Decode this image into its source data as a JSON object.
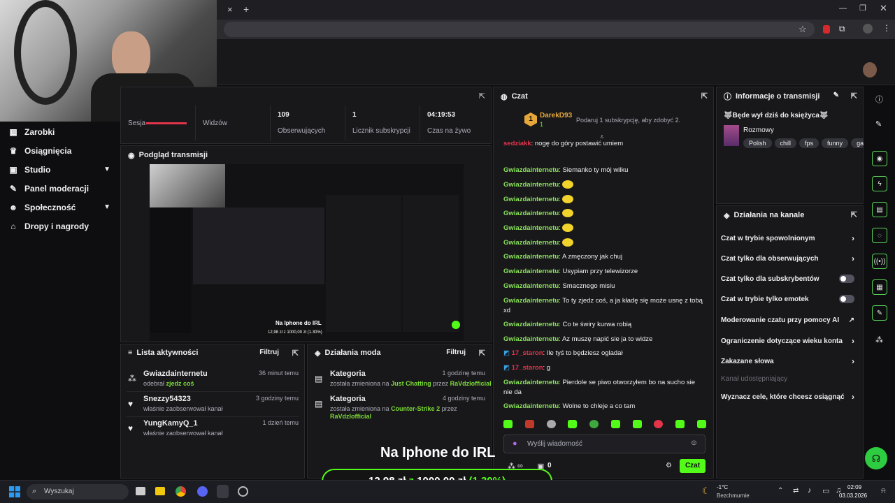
{
  "browser": {
    "new_tab": "+",
    "close": "×"
  },
  "sidebar": {
    "items": [
      {
        "icon": "bar-chart-icon",
        "glyph": "▦",
        "label": "Zarobki"
      },
      {
        "icon": "trophy-icon",
        "glyph": "♛",
        "label": "Osiągnięcia"
      },
      {
        "icon": "studio-icon",
        "glyph": "▣",
        "label": "Studio",
        "chevron": true
      },
      {
        "icon": "wrench-icon",
        "glyph": "✎",
        "label": "Panel moderacji"
      },
      {
        "icon": "community-icon",
        "glyph": "☻",
        "label": "Społeczność",
        "chevron": true
      },
      {
        "icon": "gift-icon",
        "glyph": "⌂",
        "label": "Dropy i nagrody"
      }
    ]
  },
  "stats": [
    {
      "value": "",
      "label": "Sesja"
    },
    {
      "value": "",
      "label": "Widzów"
    },
    {
      "value": "109",
      "label": "Obserwujących"
    },
    {
      "value": "1",
      "label": "Licznik subskrypcji"
    },
    {
      "value": "04:19:53",
      "label": "Czas na żywo"
    }
  ],
  "preview": {
    "title": "Podgląd transmisji",
    "overlay_text": "Na Iphone do IRL",
    "overlay_amount": "12,98 zł z 1000,00 zł (1.30%)"
  },
  "activity": {
    "title": "Lista aktywności",
    "filter": "Filtruj",
    "items": [
      {
        "name": "Gwiazdainternetu",
        "sub_pre": "odebrał ",
        "sub_hl": "zjedz coś",
        "time": "36 minut temu"
      },
      {
        "name": "Snezzy54323",
        "sub_pre": "właśnie zaobserwował kanał",
        "sub_hl": "",
        "time": "3 godziny temu"
      },
      {
        "name": "YungKamyQ_1",
        "sub_pre": "właśnie zaobserwował kanał",
        "sub_hl": "",
        "time": "1 dzień temu"
      }
    ]
  },
  "mod_actions": {
    "title": "Działania moda",
    "filter": "Filtruj",
    "items": [
      {
        "name": "Kategoria",
        "pre": "została zmieniona na ",
        "category": "Just Chatting",
        "by": " przez ",
        "user": "RaVdzIofficial",
        "time": "1 godzinę temu"
      },
      {
        "name": "Kategoria",
        "pre": "została zmieniona na ",
        "category": "Counter-Strike 2",
        "by": " przez",
        "user": "RaVdzIofficial",
        "time": "4 godziny temu"
      }
    ]
  },
  "chat": {
    "title": "Czat",
    "top_gifter": "DarekD93",
    "top_gifter_count": "1",
    "gift_prompt": "Podaruj 1 subskrypcję, aby zdobyć 2.",
    "messages": [
      {
        "user": "sedziakk",
        "color": "red",
        "text": ": nogę do góry postawić umiem",
        "emote": false
      },
      {
        "user": "Gwiazdainternetu",
        "color": "green",
        "text": ": Siemanko ty mój wilku",
        "emote": false
      },
      {
        "user": "Gwiazdainternetu",
        "color": "green",
        "text": ":",
        "emote": true
      },
      {
        "user": "Gwiazdainternetu",
        "color": "green",
        "text": ":",
        "emote": true
      },
      {
        "user": "Gwiazdainternetu",
        "color": "green",
        "text": ":",
        "emote": true
      },
      {
        "user": "Gwiazdainternetu",
        "color": "green",
        "text": ":",
        "emote": true
      },
      {
        "user": "Gwiazdainternetu",
        "color": "green",
        "text": ":",
        "emote": true
      },
      {
        "user": "Gwiazdainternetu",
        "color": "green",
        "text": ": A zmęczony jak chuj",
        "emote": false
      },
      {
        "user": "Gwiazdainternetu",
        "color": "green",
        "text": ": Usypiam przy telewizorze",
        "emote": false
      },
      {
        "user": "Gwiazdainternetu",
        "color": "green",
        "text": ": Smacznego misiu",
        "emote": false
      },
      {
        "user": "Gwiazdainternetu",
        "color": "green",
        "text": ": To ty zjedz coś, a ja kładę się może usnę z tobą xd",
        "emote": false
      },
      {
        "user": "Gwiazdainternetu",
        "color": "green",
        "text": ": Co te świry kurwa robią",
        "emote": false
      },
      {
        "user": "Gwiazdainternetu",
        "color": "green",
        "text": ": Az muszę napić sie ja to widze",
        "emote": false
      },
      {
        "user": "17_staron",
        "color": "red",
        "text": ": Ile tyś to będziesz ogladał",
        "emote": false,
        "badge": true
      },
      {
        "user": "17_staron",
        "color": "red",
        "text": ": g",
        "emote": false,
        "badge": true
      },
      {
        "user": "Gwiazdainternetu",
        "color": "green",
        "text": ": Pierdole se piwo otworzyłem bo na sucho sie nie da",
        "emote": false
      },
      {
        "user": "Gwiazdainternetu",
        "color": "green",
        "text": ": Wolne to chleje a co tam",
        "emote": false
      }
    ],
    "input_placeholder": "Wyślij wiadomość",
    "points": "∞",
    "chest_count": "0",
    "send_label": "Czat"
  },
  "info": {
    "title": "Informacje o transmisji",
    "stream_title": "🐺Będe wył dziś do księżyca🐺",
    "category": "Rozmowy",
    "tags": [
      "Polish",
      "chill",
      "fps",
      "funny",
      "ga"
    ]
  },
  "channel_actions": {
    "title": "Działania na kanale",
    "items": [
      {
        "label": "Czat w trybie spowolnionym",
        "kind": "chevron"
      },
      {
        "label": "Czat tylko dla obserwujących",
        "kind": "chevron"
      },
      {
        "label": "Czat tylko dla subskrybentów",
        "kind": "toggle"
      },
      {
        "label": "Czat w trybie tylko emotek",
        "kind": "toggle"
      },
      {
        "label": "Moderowanie czatu przy pomocy AI",
        "kind": "external"
      },
      {
        "label": "Ograniczenie dotyczące wieku konta",
        "kind": "chevron"
      },
      {
        "label": "Zakazane słowa",
        "kind": "chevron"
      },
      {
        "label": "Kanał udostępniający",
        "kind": "disabled"
      },
      {
        "label": "Wyznacz cele, które chcesz osiągnąć",
        "kind": "chevron"
      }
    ]
  },
  "overlay": {
    "title": "Na Iphone do IRL",
    "amount_current": "12,98 zł",
    "amount_of": "z",
    "amount_goal": "1000,00 zł",
    "percent": "(1.30%)"
  },
  "taskbar": {
    "search_placeholder": "Wyszukaj",
    "weather_temp": "-1°C",
    "weather_desc": "Bezchmurnie",
    "time": "02:09",
    "date": "03.03.2026"
  },
  "colors": {
    "accent": "#53fc18",
    "bg": "#0e0e10",
    "panel": "#18181b"
  }
}
